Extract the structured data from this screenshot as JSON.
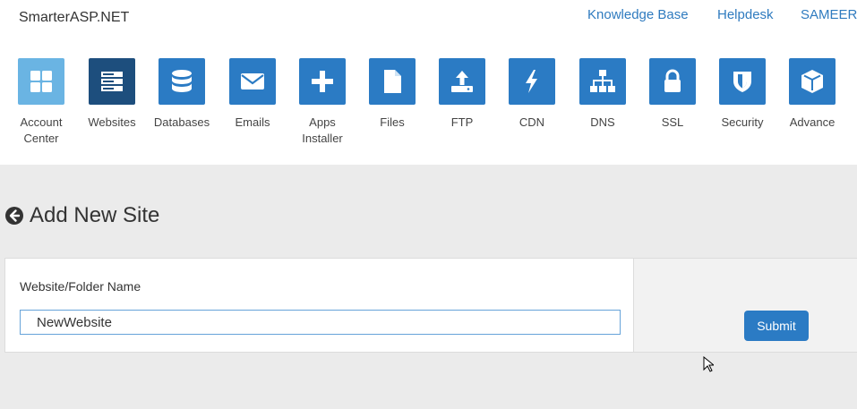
{
  "brand": "SmarterASP.NET",
  "top_links": {
    "knowledge_base": "Knowledge Base",
    "helpdesk": "Helpdesk",
    "user": "SAMEER"
  },
  "nav": [
    {
      "label": "Account Center",
      "icon": "grid-icon"
    },
    {
      "label": "Websites",
      "icon": "server-icon"
    },
    {
      "label": "Databases",
      "icon": "database-icon"
    },
    {
      "label": "Emails",
      "icon": "envelope-icon"
    },
    {
      "label": "Apps Installer",
      "icon": "plus-icon"
    },
    {
      "label": "Files",
      "icon": "file-icon"
    },
    {
      "label": "FTP",
      "icon": "upload-icon"
    },
    {
      "label": "CDN",
      "icon": "bolt-icon"
    },
    {
      "label": "DNS",
      "icon": "sitemap-icon"
    },
    {
      "label": "SSL",
      "icon": "lock-icon"
    },
    {
      "label": "Security",
      "icon": "shield-icon"
    },
    {
      "label": "Advance",
      "icon": "cube-icon"
    }
  ],
  "page": {
    "title": "Add New Site"
  },
  "form": {
    "label": "Website/Folder Name",
    "value": "NewWebsite",
    "submit_label": "Submit"
  },
  "colors": {
    "accent": "#2b7bc4",
    "tile_light": "#6ab4e3",
    "tile_dark": "#1d4e7d",
    "link": "#2f7bbf",
    "background": "#ebebeb"
  }
}
